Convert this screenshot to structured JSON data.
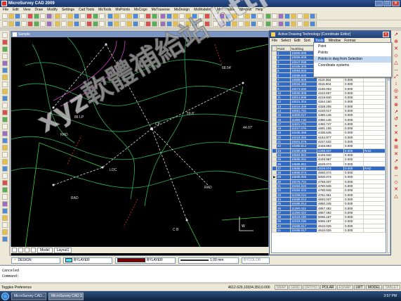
{
  "app": {
    "title": "MicroSurvey CAD 2009"
  },
  "menu": [
    "File",
    "Edit",
    "View",
    "Draw",
    "Modify",
    "Settings",
    "Cad Tools",
    "MsTools",
    "MsPoints",
    "MsCogo",
    "MsTraverse",
    "MsDesign",
    "MsModeling",
    "Multinitable",
    "Window",
    "Help"
  ],
  "drawing": {
    "title": "Sample",
    "labels": [
      "86 LP",
      "68.54'",
      "CP",
      "RAD",
      "RAD",
      "59.8'",
      "LOC",
      "RAD",
      "C B",
      "44.07'"
    ]
  },
  "layout_tabs": [
    "Model",
    "Layout1"
  ],
  "props": {
    "layer": "DESIGN",
    "color": "BYLAYER",
    "linetype": "BYLAYER",
    "lineweight": "1.00 mm",
    "style": "BYCOLOR"
  },
  "cmdline": [
    "Canceled",
    "Command:"
  ],
  "status": {
    "left": "Toggles Preference",
    "coords": "4612.629,10334.350,0.000",
    "modes": [
      "SNAP",
      "GRID",
      "ORTHO",
      "POLAR",
      "ESNAP",
      "LWT",
      "MODEL",
      "TABLET"
    ],
    "active_modes": [
      "POLAR",
      "LWT",
      "MODEL"
    ]
  },
  "taskbar": {
    "tasks": [
      "MicroSurvey CAD...",
      "MicroSurvey CAD 2..."
    ],
    "clock": "3:57 PM"
  },
  "dialog": {
    "title": "Active Drawing Technology",
    "subtitle": "[Coordinate Editor]",
    "menu": [
      "File",
      "Select",
      "Edit",
      "Sort",
      "Tools",
      "Window",
      "Format"
    ],
    "active_menu": "Tools",
    "columns": [
      "Point",
      "Northing",
      "Easting",
      "Elev",
      "Desc"
    ],
    "dropdown": [
      "Point",
      "Points",
      "Points in dwg from Selection",
      "Coordinate systems"
    ],
    "rows": [
      [
        "1",
        "10000.000",
        "",
        "",
        ""
      ],
      [
        "2",
        "10006.009",
        "",
        "",
        ""
      ],
      [
        "3",
        "10047.098",
        "",
        "",
        ""
      ],
      [
        "4",
        "10105.300",
        "",
        "",
        ""
      ],
      [
        "5",
        "10093.500",
        "",
        "",
        ""
      ],
      [
        "6",
        "10089.660",
        "4121.340",
        "0.000",
        ""
      ],
      [
        "7",
        "10068.000",
        "4115.364",
        "0.000",
        ""
      ],
      [
        "8",
        "10034.463",
        "4118.904",
        "0.000",
        ""
      ],
      [
        "9",
        "10073.550",
        "4160.003",
        "0.000",
        ""
      ],
      [
        "10",
        "10030.308",
        "4222.507",
        "0.000",
        ""
      ],
      [
        "11",
        "10013.898",
        "4219.840",
        "0.000",
        ""
      ],
      [
        "12",
        "10221.304",
        "4264.160",
        "0.000",
        ""
      ],
      [
        "13",
        "10416.359",
        "4328.205",
        "0.000",
        ""
      ],
      [
        "14",
        "10061.761",
        "4220.017",
        "0.000",
        ""
      ],
      [
        "15",
        "11000.817",
        "4380.146",
        "0.000",
        ""
      ],
      [
        "16",
        "11490.718",
        "4380.146",
        "0.000",
        ""
      ],
      [
        "17",
        "11521.776",
        "4492.747",
        "0.000",
        ""
      ],
      [
        "18",
        "11017.579",
        "4691.106",
        "0.000",
        ""
      ],
      [
        "19",
        "10435.385",
        "4436.645",
        "0.000",
        ""
      ],
      [
        "20",
        "10218.355",
        "4154.977",
        "0.000",
        ""
      ],
      [
        "21",
        "10401.076",
        "4227.532",
        "0.000",
        ""
      ],
      [
        "22",
        "10385.812",
        "4449.893",
        "0.000",
        ""
      ],
      [
        "23",
        "10490.409",
        "4288.937",
        "0.000",
        "RAD"
      ],
      [
        "24",
        "10584.851",
        "4449.940",
        "0.000",
        ""
      ],
      [
        "25",
        "10685.051",
        "4449.987",
        "0.000",
        ""
      ],
      [
        "26",
        "10685.061",
        "4529.074",
        "0.000",
        ""
      ],
      [
        "27",
        "10685.062",
        "4529.074",
        "0.000",
        "RAD"
      ],
      [
        "28",
        "10685.074",
        "4650.074",
        "0.000",
        ""
      ],
      [
        "29",
        "10685.050",
        "5000.074",
        "0.000",
        ""
      ],
      [
        "30",
        "10276.701",
        "4769.037",
        "0.000",
        ""
      ],
      [
        "31",
        "10484.022",
        "4780.945",
        "0.000",
        ""
      ],
      [
        "32",
        "10484.022",
        "4780.945",
        "0.000",
        ""
      ],
      [
        "33",
        "11236.014",
        "4761.061",
        "0.000",
        ""
      ],
      [
        "34",
        "10485.012",
        "4840.037",
        "0.000",
        ""
      ],
      [
        "35",
        "10485.014",
        "4860.245",
        "0.000",
        ""
      ],
      [
        "36",
        "11290.022",
        "4857.482",
        "0.000",
        ""
      ],
      [
        "37",
        "11290.022",
        "4857.482",
        "0.000",
        ""
      ],
      [
        "38",
        "11018.238",
        "5066.187",
        "0.000",
        ""
      ],
      [
        "39",
        "11018.238",
        "5066.187",
        "0.000",
        ""
      ],
      [
        "40",
        "10485.017",
        "4610.025",
        "0.000",
        ""
      ],
      [
        "41",
        "10485.017",
        "4610.025",
        "0.000",
        ""
      ]
    ],
    "highlight_rows": [
      22,
      26
    ],
    "selected_rows": [
      0,
      1,
      2,
      3,
      4,
      5,
      6,
      7,
      8,
      9,
      10,
      11,
      12,
      13,
      14,
      15,
      16,
      17,
      18,
      19,
      20,
      21,
      23,
      24,
      25,
      27,
      28,
      29,
      30,
      31,
      32,
      33,
      34,
      35,
      36,
      37,
      38,
      39,
      40
    ]
  },
  "watermark": "xyz軟體補給站 http://31.to"
}
